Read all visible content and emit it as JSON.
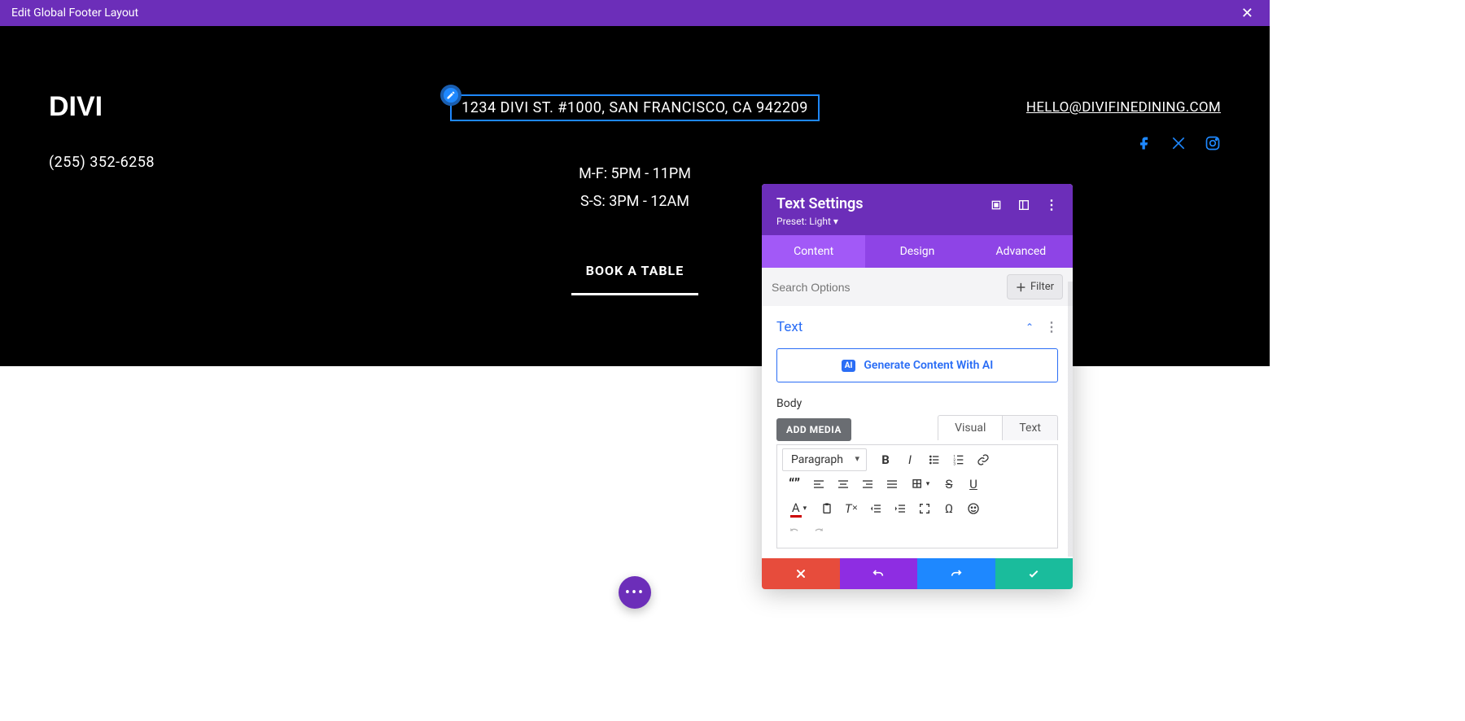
{
  "top_bar": {
    "title": "Edit Global Footer Layout"
  },
  "footer": {
    "brand": "DIVI",
    "phone": "(255) 352-6258",
    "address": "1234 DIVI ST. #1000, SAN FRANCISCO, CA 942209",
    "hours_weekday": "M-F: 5PM - 11PM",
    "hours_weekend": "S-S: 3PM - 12AM",
    "cta": "BOOK A TABLE",
    "email": "HELLO@DIVIFINEDINING.COM"
  },
  "panel": {
    "title": "Text Settings",
    "preset": "Preset: Light ▾",
    "tabs": {
      "content": "Content",
      "design": "Design",
      "advanced": "Advanced"
    },
    "search_placeholder": "Search Options",
    "filter_label": "Filter",
    "section_title": "Text",
    "generate_label": "Generate Content With AI",
    "ai_badge": "AI",
    "body_label": "Body",
    "add_media": "ADD MEDIA",
    "visual_tab": "Visual",
    "text_tab": "Text",
    "paragraph_select": "Paragraph"
  },
  "colors": {
    "accent": "#6c2eb9",
    "selection_blue": "#1e88ff",
    "link_blue": "#2a6df5"
  }
}
